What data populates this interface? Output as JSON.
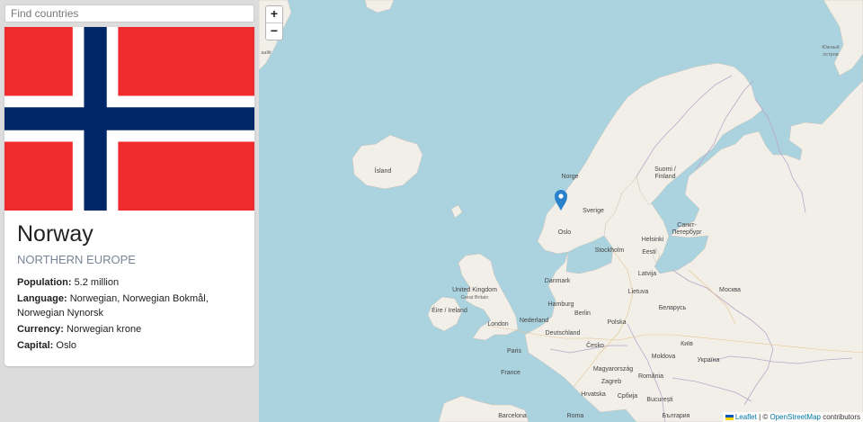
{
  "search": {
    "placeholder": "Find countries"
  },
  "country": {
    "name": "Norway",
    "region": "NORTHERN EUROPE",
    "flag": {
      "red": "#ef2b2d",
      "white": "#ffffff",
      "blue": "#002868"
    },
    "facts": [
      {
        "label": "Population:",
        "value": "5.2 million"
      },
      {
        "label": "Language:",
        "value": "Norwegian, Norwegian Bokmål, Norwegian Nynorsk"
      },
      {
        "label": "Currency:",
        "value": "Norwegian krone"
      },
      {
        "label": "Capital:",
        "value": "Oslo"
      }
    ]
  },
  "map": {
    "zoom_in": "+",
    "zoom_out": "−",
    "marker_color": "#2a81cb",
    "colors": {
      "water": "#aad3df",
      "land": "#f2efe9",
      "border": "#b9a8c8"
    },
    "labels": {
      "island": "Ísland",
      "norge": "Norge",
      "sverige": "Sverige",
      "suomi": "Suomi /",
      "finland": "Finland",
      "spb": "Санкт-",
      "spb2": "Петербург",
      "oslo": "Oslo",
      "stockholm": "Stockholm",
      "helsinki": "Helsinki",
      "eesti": "Eesti",
      "latvija": "Latvija",
      "lietuva": "Lietuva",
      "danmark": "Danmark",
      "uk": "United Kingdom",
      "gb": "Great Britain",
      "eire": "Éire / Ireland",
      "london": "London",
      "nederland": "Nederland",
      "hamburg": "Hamburg",
      "berlin": "Berlin",
      "deutschland": "Deutschland",
      "polska": "Polska",
      "belarus": "Беларусь",
      "moskva": "Москва",
      "kyiv": "Київ",
      "ukraina": "Україна",
      "paris": "Paris",
      "france": "France",
      "cesko": "Česko",
      "magyar": "Magyarország",
      "moldova": "Moldova",
      "romania": "România",
      "zagreb": "Zagreb",
      "hrvatska": "Hrvatska",
      "srbija": "Србија",
      "bucuresti": "București",
      "barcelona": "Barcelona",
      "roma": "Roma",
      "bulgaria": "България",
      "saallit": "aallit",
      "yuzhny": "Южный",
      "ostrov": "остров"
    },
    "attribution": {
      "leaflet": "Leaflet",
      "sep": " | © ",
      "osm": "OpenStreetMap",
      "contributors": " contributors"
    }
  }
}
